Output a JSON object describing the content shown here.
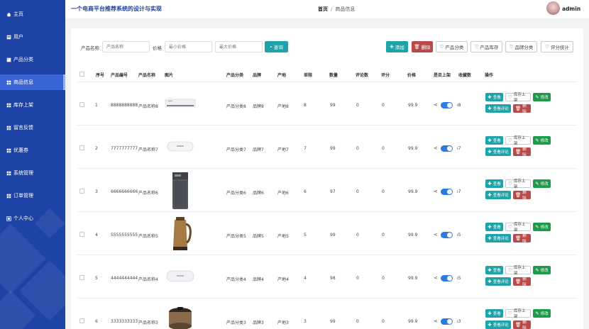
{
  "app_title": "一个电商平台推荐系统的设计与实现",
  "breadcrumb": {
    "home": "首页",
    "separator": "/",
    "current": "商品信息"
  },
  "user": {
    "name": "admin"
  },
  "sidebar": {
    "items": [
      {
        "label": "主页",
        "icon": "home-icon"
      },
      {
        "label": "用户",
        "icon": "user-icon"
      },
      {
        "label": "产品分类",
        "icon": "category-icon"
      },
      {
        "label": "商品信息",
        "icon": "grid-icon",
        "active": true
      },
      {
        "label": "库存上架",
        "icon": "grid-icon"
      },
      {
        "label": "留言反馈",
        "icon": "grid-icon"
      },
      {
        "label": "优惠券",
        "icon": "grid-icon"
      },
      {
        "label": "系统管理",
        "icon": "grid-icon"
      },
      {
        "label": "订单管理",
        "icon": "grid-icon"
      },
      {
        "label": "个人中心",
        "icon": "person-icon"
      }
    ]
  },
  "search": {
    "name_label": "产品名称",
    "name_placeholder": "产品名称",
    "price_label": "价格",
    "min_price_placeholder": "最小价格",
    "max_price_placeholder": "最大价格",
    "query_button": "查询"
  },
  "toolbar": {
    "add": "添加",
    "delete": "删除",
    "category": "产品分类",
    "inventory": "产品库存",
    "brand_category": "品牌分类",
    "rating_stats": "评分统计"
  },
  "table": {
    "headers": {
      "index": "序号",
      "code": "产品编号",
      "name": "产品名称",
      "image": "图片",
      "category": "产品分类",
      "brand": "品牌",
      "origin": "产地",
      "unit_price": "单限",
      "quantity": "数量",
      "reviews": "评论数",
      "rating": "评分",
      "price": "价格",
      "on_shelf": "是否上架",
      "favorites": "收藏数",
      "actions": "操作"
    },
    "rows": [
      {
        "index": "1",
        "code": "8888888888",
        "name": "产品名称8",
        "category": "产品分类8",
        "brand": "品牌8",
        "origin": "产地8",
        "unit_price": "8",
        "quantity": "99",
        "reviews": "0",
        "rating": "0",
        "price": "99.9",
        "favorites": "8",
        "image": "range-hood"
      },
      {
        "index": "2",
        "code": "7777777777",
        "name": "产品名称7",
        "category": "产品分类7",
        "brand": "品牌7",
        "origin": "产地7",
        "unit_price": "7",
        "quantity": "99",
        "reviews": "0",
        "rating": "0",
        "price": "99.9",
        "favorites": "7",
        "image": "water-heater"
      },
      {
        "index": "3",
        "code": "6666666666",
        "name": "产品名称6",
        "category": "产品分类6",
        "brand": "品牌6",
        "origin": "产地6",
        "unit_price": "6",
        "quantity": "97",
        "reviews": "0",
        "rating": "0",
        "price": "99.9",
        "favorites": "7",
        "image": "washing-machine"
      },
      {
        "index": "4",
        "code": "5555555555",
        "name": "产品名称5",
        "category": "产品分类5",
        "brand": "品牌5",
        "origin": "产地5",
        "unit_price": "5",
        "quantity": "99",
        "reviews": "0",
        "rating": "0",
        "price": "99.9",
        "favorites": "5",
        "image": "kettle"
      },
      {
        "index": "5",
        "code": "4444444444",
        "name": "产品名称4",
        "category": "产品分类4",
        "brand": "品牌4",
        "origin": "产地4",
        "unit_price": "4",
        "quantity": "98",
        "reviews": "0",
        "rating": "0",
        "price": "99.9",
        "favorites": "5",
        "image": "water-heater"
      },
      {
        "index": "6",
        "code": "3333333333",
        "name": "产品名称3",
        "category": "产品分类3",
        "brand": "品牌3",
        "origin": "产地3",
        "unit_price": "3",
        "quantity": "99",
        "reviews": "0",
        "rating": "0",
        "price": "99.9",
        "favorites": "3",
        "image": "rice-cooker"
      }
    ],
    "row_actions": {
      "view": "查看",
      "shelve": "库存上架",
      "edit": "修改",
      "view_reviews": "查看评论",
      "delete": "删除"
    }
  },
  "colors": {
    "sidebar": "#1e43a6",
    "sidebar_active": "#3a65d6",
    "teal": "#1fa3a8",
    "danger": "#b84a4a",
    "success": "#1f9a4a",
    "toggle_on": "#2c7be5"
  }
}
